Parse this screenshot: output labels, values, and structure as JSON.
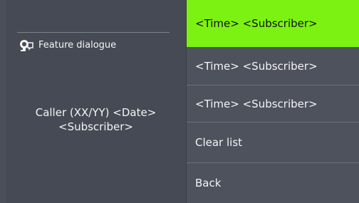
{
  "left_panel": {
    "feature_label": "Feature dialogue",
    "feature_icon": "feature-dialogue-icon",
    "caller_line1": "Caller (XX/YY) <Date>",
    "caller_line2": "<Subscriber>"
  },
  "menu": {
    "items": [
      {
        "label": "<Time> <Subscriber>",
        "selected": true
      },
      {
        "label": "<Time> <Subscriber>",
        "selected": false
      },
      {
        "label": "<Time> <Subscriber>",
        "selected": false
      },
      {
        "label": "Clear list",
        "selected": false
      },
      {
        "label": "Back",
        "selected": false
      }
    ]
  },
  "colors": {
    "background": "#4a4f59",
    "selected_highlight": "#7cf213",
    "text": "#f4f4f4"
  }
}
